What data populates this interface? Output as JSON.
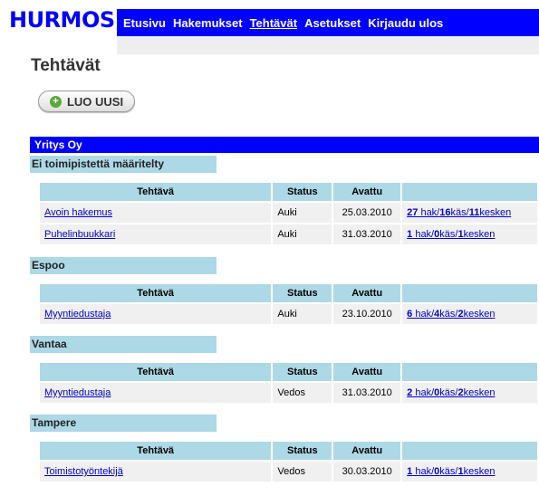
{
  "app": {
    "logo": "HURMOS"
  },
  "nav": {
    "items": [
      {
        "label": "Etusivu",
        "active": false
      },
      {
        "label": "Hakemukset",
        "active": false
      },
      {
        "label": "Tehtävät",
        "active": true
      },
      {
        "label": "Asetukset",
        "active": false
      },
      {
        "label": "Kirjaudu ulos",
        "active": false
      }
    ]
  },
  "page": {
    "title": "Tehtävät",
    "new_button": "LUO UUSI"
  },
  "company": "Yritys Oy",
  "table_headers": {
    "task": "Tehtävä",
    "status": "Status",
    "opened": "Avattu",
    "summary": ""
  },
  "locations": [
    {
      "name": "Ei toimipistettä määritelty",
      "rows": [
        {
          "task": "Avoin hakemus",
          "status": "Auki",
          "opened": "25.03.2010",
          "s1": "27",
          "s1t": " hak/",
          "s2": "16",
          "s2t": "käs/",
          "s3": "11",
          "s3t": "kesken"
        },
        {
          "task": "Puhelinbuukkari",
          "status": "Auki",
          "opened": "31.03.2010",
          "s1": "1",
          "s1t": " hak/",
          "s2": "0",
          "s2t": "käs/",
          "s3": "1",
          "s3t": "kesken"
        }
      ]
    },
    {
      "name": "Espoo",
      "rows": [
        {
          "task": "Myyntiedustaja",
          "status": "Auki",
          "opened": "23.10.2010",
          "s1": "6",
          "s1t": " hak/",
          "s2": "4",
          "s2t": "käs/",
          "s3": "2",
          "s3t": "kesken"
        }
      ]
    },
    {
      "name": "Vantaa",
      "rows": [
        {
          "task": "Myyntiedustaja",
          "status": "Vedos",
          "opened": "31.03.2010",
          "s1": "2",
          "s1t": " hak/",
          "s2": "0",
          "s2t": "käs/",
          "s3": "2",
          "s3t": "kesken"
        }
      ]
    },
    {
      "name": "Tampere",
      "rows": [
        {
          "task": "Toimistotyöntekijä",
          "status": "Vedos",
          "opened": "30.03.2010",
          "s1": "1",
          "s1t": " hak/",
          "s2": "0",
          "s2t": "käs/",
          "s3": "1",
          "s3t": "kesken"
        }
      ]
    }
  ]
}
